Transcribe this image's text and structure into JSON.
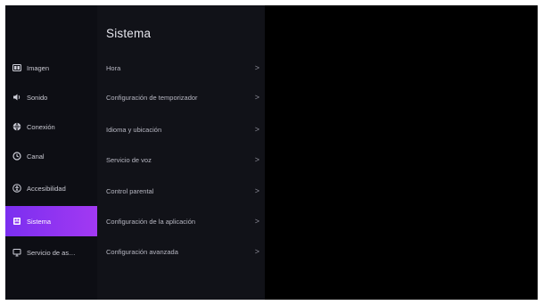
{
  "sidebar": {
    "items": [
      {
        "label": "Imagen",
        "icon": "image-icon",
        "active": false
      },
      {
        "label": "Sonido",
        "icon": "speaker-icon",
        "active": false
      },
      {
        "label": "Conexión",
        "icon": "globe-icon",
        "active": false
      },
      {
        "label": "Canal",
        "icon": "channel-icon",
        "active": false
      },
      {
        "label": "Accesibilidad",
        "icon": "accessibility-icon",
        "active": false
      },
      {
        "label": "Sistema",
        "icon": "system-icon",
        "active": true
      },
      {
        "label": "Servicio de as…",
        "icon": "support-icon",
        "active": false
      }
    ]
  },
  "panel": {
    "title": "Sistema",
    "items": [
      {
        "label": "Hora"
      },
      {
        "label": "Configuración de temporizador"
      },
      {
        "label": "Idioma y ubicación"
      },
      {
        "label": "Servicio de voz"
      },
      {
        "label": "Control parental"
      },
      {
        "label": "Configuración de la aplicación"
      },
      {
        "label": "Configuración avanzada"
      }
    ],
    "chevron": ">"
  },
  "colors": {
    "background": "#000000",
    "sidebar": "#0d0e14",
    "panel": "#111218",
    "accent_start": "#7b2ff0",
    "accent_end": "#a239f2"
  }
}
